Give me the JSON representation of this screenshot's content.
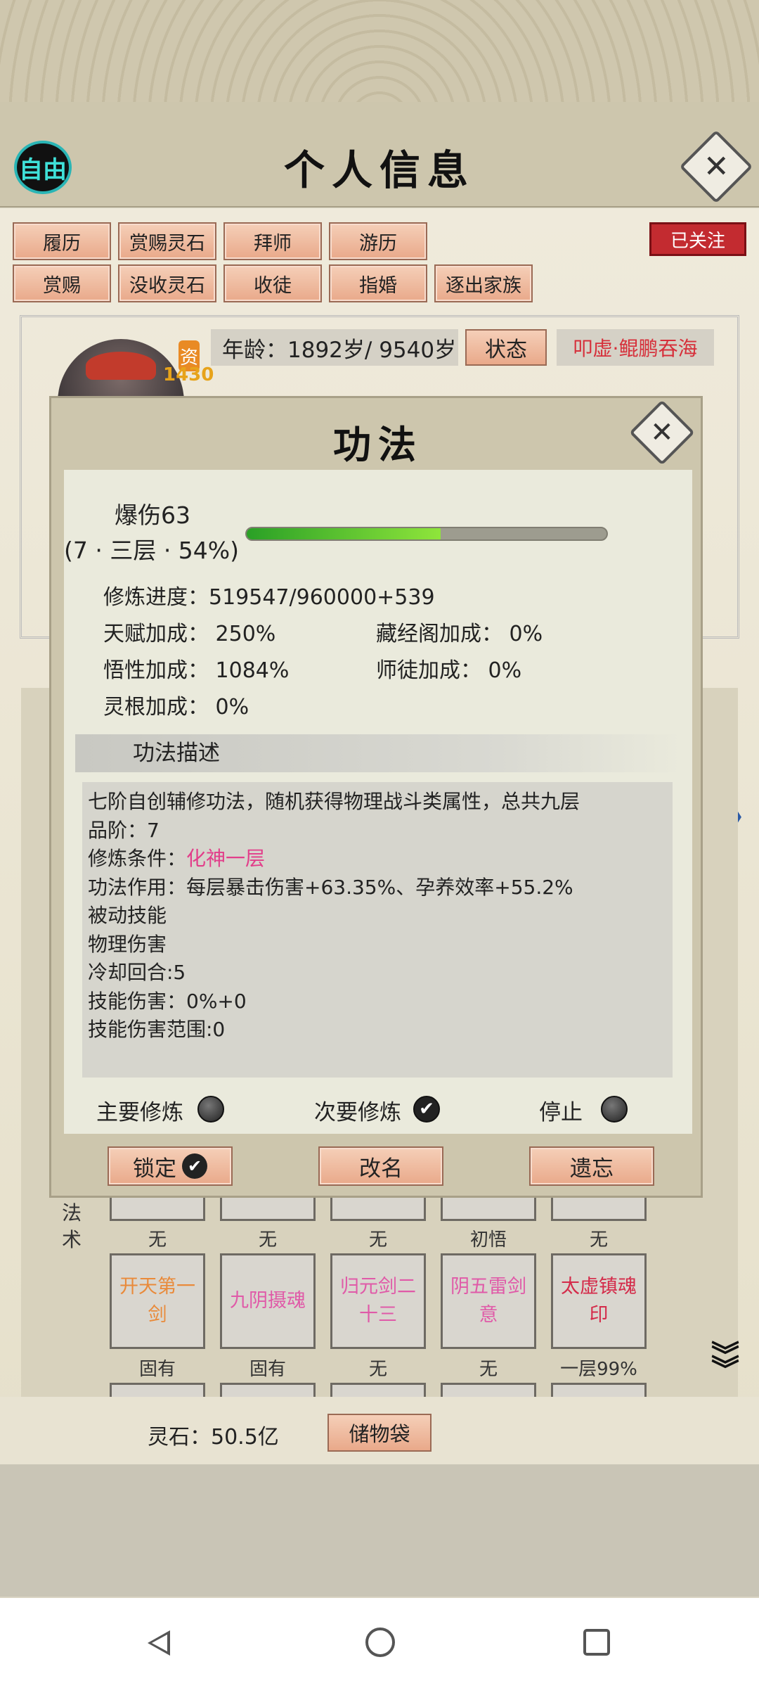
{
  "header": {
    "badge": "自由",
    "title": "个人信息"
  },
  "action_buttons_row1": [
    "履历",
    "赏赐灵石",
    "拜师",
    "游历"
  ],
  "action_buttons_row2": [
    "赏赐",
    "没收灵石",
    "收徒",
    "指婚",
    "逐出家族"
  ],
  "follow_badge": "已关注",
  "profile": {
    "resource_label": "资",
    "resource_value": "1430",
    "age": "年龄：1892岁/ 9540岁",
    "status_button": "状态",
    "realm": "叩虚·鲲鹏吞海"
  },
  "modal": {
    "title": "功法",
    "skill_name": "爆伤63",
    "skill_level": "(7 · 三层 · 54%)",
    "progress_percent": 54,
    "progress_text": "修炼进度：519547/960000+539",
    "talent_bonus": "天赋加成：  250%",
    "library_bonus": "藏经阁加成：  0%",
    "insight_bonus": "悟性加成：  1084%",
    "master_bonus": "师徒加成：     0%",
    "root_bonus": "灵根加成：  0%",
    "section_title": "功法描述",
    "description": {
      "line1": "七阶自创辅修功法，随机获得物理战斗类属性，总共九层",
      "line2": "品阶：7",
      "line3_label": "修炼条件：",
      "line3_value": "化神一层",
      "line4": "功法作用：每层暴击伤害+63.35%、孕养效率+55.2%",
      "line5": "被动技能",
      "line6": "物理伤害",
      "line7": "冷却回合:5",
      "line8": "技能伤害：0%+0",
      "line9": "技能伤害范围:0"
    },
    "radio_main": "主要修炼",
    "radio_secondary": "次要修炼",
    "radio_stop": "停止",
    "btn_lock": "锁定",
    "btn_rename": "改名",
    "btn_forget": "遗忘"
  },
  "skills": {
    "section_label": "法术",
    "top_captions": [
      "无",
      "无",
      "无",
      "初悟",
      "无"
    ],
    "cells": [
      {
        "name": "开天第一剑",
        "color": "#e98a3a"
      },
      {
        "name": "九阴摄魂",
        "color": "#e05aa8"
      },
      {
        "name": "归元剑二十三",
        "color": "#e05aa8"
      },
      {
        "name": "阴五雷剑意",
        "color": "#e05aa8"
      },
      {
        "name": "太虚镇魂印",
        "color": "#d42b4a"
      }
    ],
    "bottom_captions": [
      "固有",
      "固有",
      "无",
      "无",
      "一层99%"
    ]
  },
  "bottom": {
    "stones": "灵石：50.5亿",
    "bag_button": "储物袋"
  },
  "icons": [
    "close-icon",
    "left-arrow-icon",
    "right-arrow-icon",
    "down-chevrons-icon",
    "check-icon",
    "back-icon",
    "home-icon",
    "recent-apps-icon"
  ]
}
